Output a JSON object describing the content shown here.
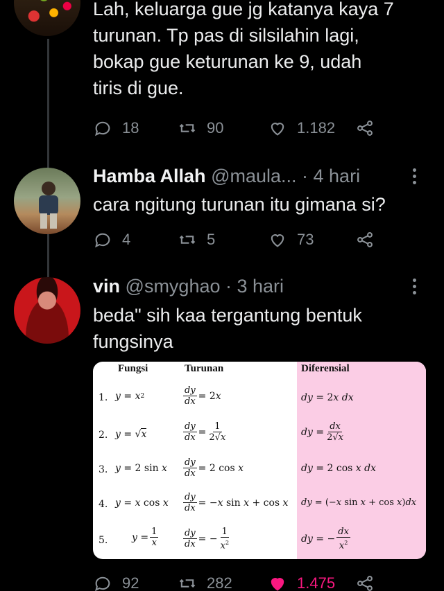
{
  "tweet_top": {
    "text_lines": [
      "Lah, keluarga gue jg katanya kaya 7",
      "turunan. Tp pas di silsilahin lagi,",
      "bokap gue keturunan ke 9, udah",
      "tiris di gue."
    ],
    "replies": "18",
    "retweets": "90",
    "likes": "1.182"
  },
  "tweet_hamba": {
    "name": "Hamba Allah",
    "handle": "@maula...",
    "time": "· 4 hari",
    "text": "cara ngitung turunan itu gimana si?",
    "replies": "4",
    "retweets": "5",
    "likes": "73"
  },
  "tweet_vin": {
    "name": "vin",
    "handle": "@smyghao",
    "time": "· 3 hari",
    "text_lines": [
      "beda\" sih kaa tergantung bentuk",
      "fungsinya"
    ],
    "replies": "92",
    "retweets": "282",
    "likes": "1.475"
  },
  "table": {
    "headers": [
      "Fungsi",
      "Turunan",
      "Diferensial"
    ],
    "rows": [
      {
        "n": "1.",
        "f": "y = x²",
        "t_num": "dy",
        "t_den": "dx",
        "t_rhs": "= 2x",
        "d": "dy = 2x dx"
      },
      {
        "n": "2.",
        "f": "y = √x",
        "t_num": "dy",
        "t_den": "dx",
        "t_rhs": "= 1 / 2√x",
        "d": "dy = dx / 2√x"
      },
      {
        "n": "3.",
        "f": "y = 2 sin x",
        "t_num": "dy",
        "t_den": "dx",
        "t_rhs": "= 2 cos x",
        "d": "dy = 2 cos x dx"
      },
      {
        "n": "4.",
        "f": "y = x cos x",
        "t_num": "dy",
        "t_den": "dx",
        "t_rhs": "= −x sin x + cos x",
        "d": "dy = (−x sin x + cos x)dx"
      },
      {
        "n": "5.",
        "f": "y = 1 / x",
        "t_num": "dy",
        "t_den": "dx",
        "t_rhs": "= − 1 / x²",
        "d": "dy = − dx / x²"
      }
    ]
  },
  "colors": {
    "background": "#000000",
    "text": "#e7e9ea",
    "muted": "#8b9197",
    "like_active": "#f91880",
    "table_pink": "#fbcde5"
  },
  "icons": [
    "reply-icon",
    "retweet-icon",
    "like-icon",
    "share-icon",
    "more-icon"
  ]
}
